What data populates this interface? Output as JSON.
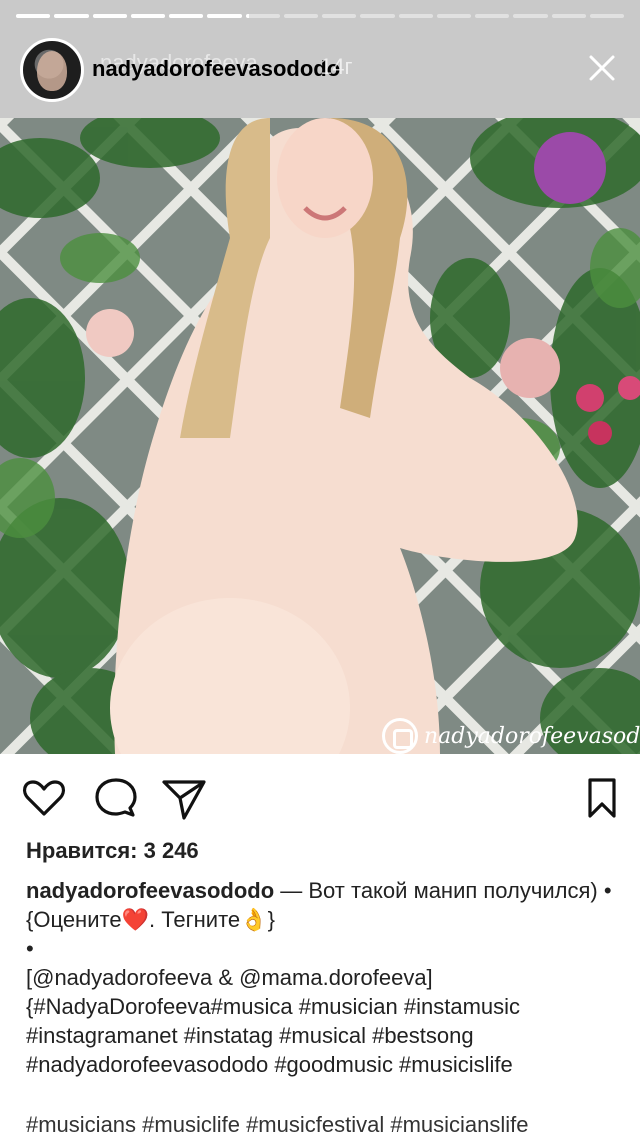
{
  "story": {
    "segments": [
      1,
      1,
      1,
      1,
      1,
      1,
      0.1,
      0,
      0,
      0,
      0,
      0,
      0,
      0,
      0,
      0
    ],
    "username": "nadyadorofeevasododo",
    "ghost_username": "nadyadorofeeva",
    "time": "14г"
  },
  "post": {
    "likes": "Нравится: 3 246",
    "caption_user": "nadyadorofeevasododo",
    "caption_line1": " — Вот такой манип получился) •",
    "caption_line2_a": "{Оцените",
    "caption_heart": "❤️",
    "caption_line2_b": ". Тегните",
    "caption_ok": "👌",
    "caption_line2_c": "}",
    "caption_line3": "•",
    "caption_line4": "[@nadyadorofeeva & @mama.dorofeeva]",
    "caption_line5": "{#NadyaDorofeeva#musica #musician #instamusic",
    "caption_line6": "#instagramanet #instatag #musical #bestsong",
    "caption_line7": "#nadyadorofeevasododo #goodmusic  #musicislife",
    "caption_overflow": "#musicians #musiclife #musicfestival #musicianslife"
  },
  "watermark": "nadyadorofeevasododo",
  "icons": {
    "like": "heart-icon",
    "comment": "comment-icon",
    "share": "send-icon",
    "save": "bookmark-icon",
    "close": "close-icon",
    "story_send": "send-icon",
    "more": "more-dots-icon"
  }
}
